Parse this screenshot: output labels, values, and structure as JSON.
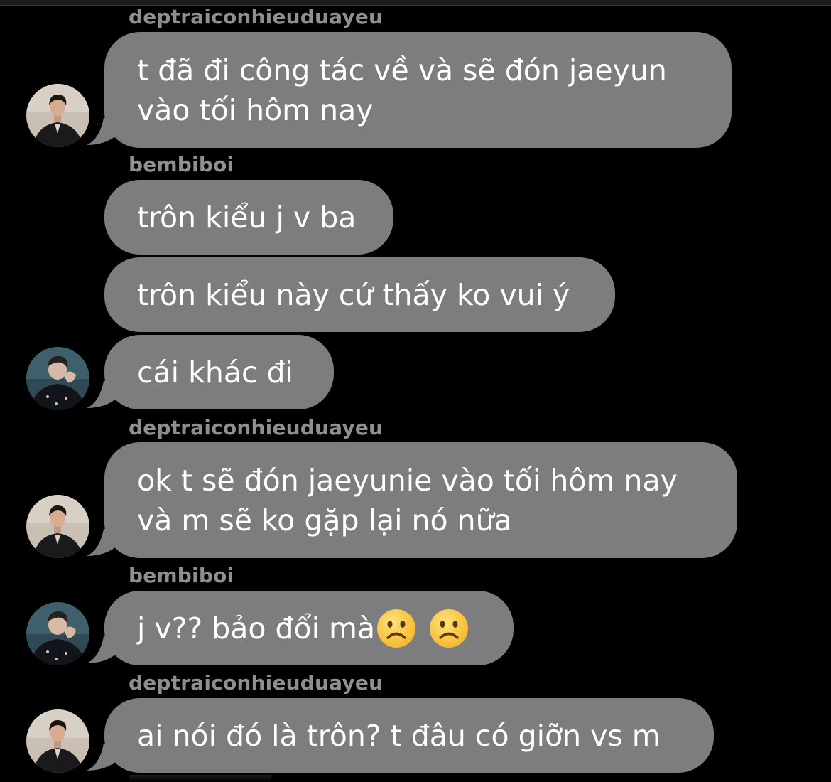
{
  "colors": {
    "background": "#000000",
    "bubble": "#7d7d7f",
    "sender": "#8e8e93",
    "text": "#ffffff"
  },
  "senders": {
    "a": "deptraiconhieuduayeu",
    "b": "bembiboi"
  },
  "messages": [
    {
      "sender_label": "deptraiconhieuduayeu",
      "text": "t đã đi công tác về và sẽ đón jaeyun\nvào tối hôm nay"
    },
    {
      "sender_label": "bembiboi",
      "text": "trôn kiểu j v ba"
    },
    {
      "text": "trôn kiểu này cứ thấy ko vui ý"
    },
    {
      "text": "cái khác đi"
    },
    {
      "sender_label": "deptraiconhieuduayeu",
      "text": "ok t sẽ đón jaeyunie vào tối hôm nay\nvà m sẽ ko gặp lại nó nữa"
    },
    {
      "sender_label": "bembiboi",
      "text": "j v?? bảo đổi mà",
      "emojis": [
        "frowning-face-emoji",
        "frowning-face-emoji"
      ]
    },
    {
      "sender_label": "deptraiconhieuduayeu",
      "text": "ai nói đó là trôn? t đâu có giỡn vs m"
    }
  ],
  "avatars": {
    "a": "avatar-deptraiconhieuduayeu",
    "b": "avatar-bembiboi"
  }
}
